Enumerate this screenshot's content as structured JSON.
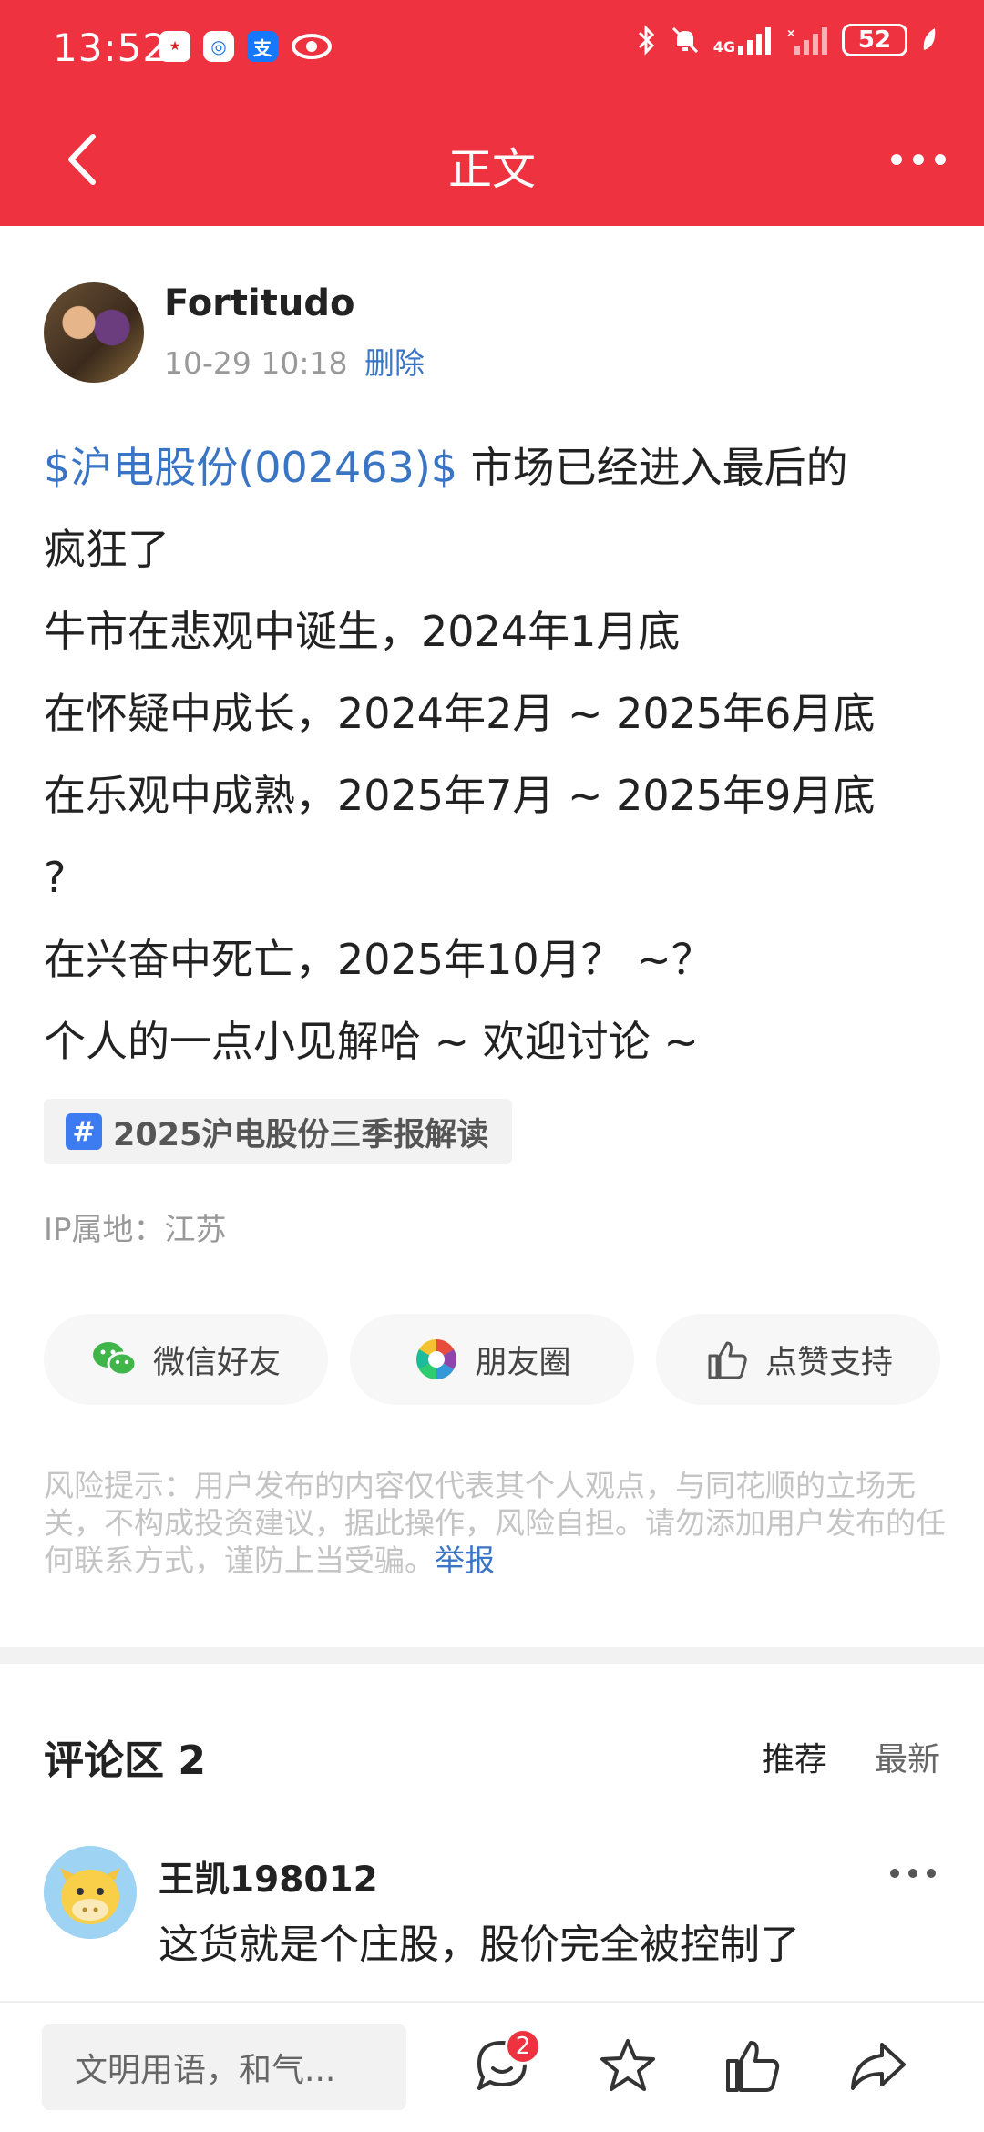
{
  "status_bar": {
    "time": "13:52",
    "battery": "52",
    "network": "4G",
    "icons": [
      "app-notification-icon",
      "app-icon",
      "alipay-icon",
      "eye-icon",
      "bluetooth-icon",
      "mute-icon",
      "signal-icon",
      "no-signal-icon",
      "battery-icon",
      "leaf-icon"
    ]
  },
  "nav": {
    "title": "正文",
    "back_icon": "back-arrow-icon",
    "more_icon": "more-icon"
  },
  "post": {
    "author": "Fortitudo",
    "date": "10-29 10:18",
    "delete_label": "删除",
    "stock_link": "$沪电股份(002463)$",
    "line1_rest": " 市场已经进入最后的",
    "line2": "疯狂了",
    "line3": "牛市在悲观中诞生，2024年1月底",
    "line4": "在怀疑中成长，2024年2月 ~ 2025年6月底",
    "line5": "在乐观中成熟，2025年7月 ~ 2025年9月底",
    "line6": "?",
    "line7": "在兴奋中死亡，2025年10月？ ~？",
    "line8": "个人的一点小见解哈 ~ 欢迎讨论 ~",
    "topic_hash": "#",
    "topic": "2025沪电股份三季报解读",
    "ip_location": "IP属地：江苏"
  },
  "share": {
    "wechat": "微信好友",
    "moments": "朋友圈",
    "like": "点赞支持"
  },
  "risk": {
    "text": "风险提示：用户发布的内容仅代表其个人观点，与同花顺的立场无关，不构成投资建议，据此操作，风险自担。请勿添加用户发布的任何联系方式，谨防上当受骗。",
    "report_label": "举报"
  },
  "comments": {
    "title": "评论区 2",
    "sort_recommend": "推荐",
    "sort_latest": "最新",
    "items": [
      {
        "user": "王凯198012",
        "text": "这货就是个庄股，股价完全被控制了"
      }
    ]
  },
  "bottom_bar": {
    "input_placeholder": "文明用语，和气...",
    "comment_badge": "2"
  },
  "colors": {
    "brand_red": "#ee3240",
    "link_blue": "#3a74c5"
  }
}
